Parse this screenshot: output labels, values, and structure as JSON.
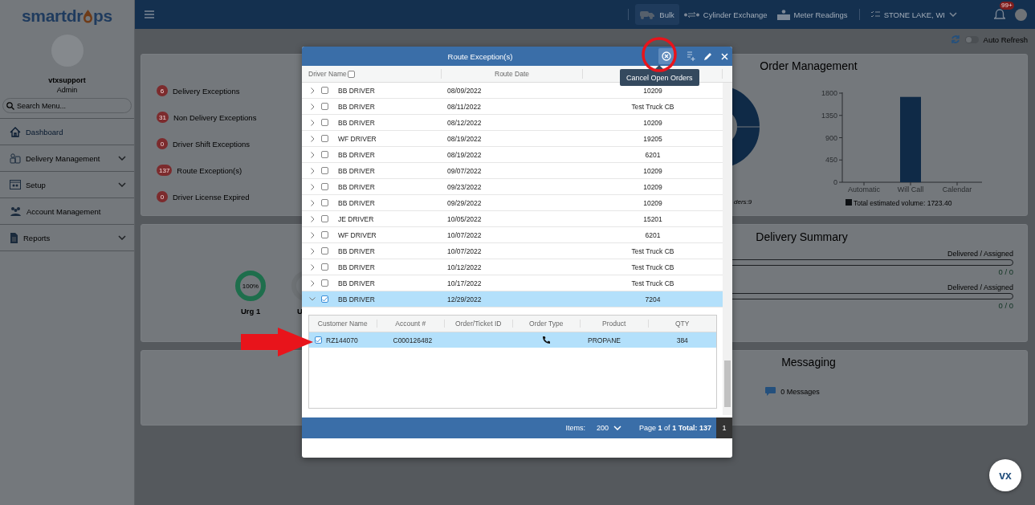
{
  "sidebar": {
    "logo": [
      "smartdr",
      "ps"
    ],
    "user": {
      "name": "vtxsupport",
      "role": "Admin"
    },
    "search": {
      "placeholder": "Search Menu..."
    },
    "items": [
      {
        "label": "Dashboard",
        "selected": true,
        "expandable": false
      },
      {
        "label": "Delivery Management",
        "selected": false,
        "expandable": true
      },
      {
        "label": "Setup",
        "selected": false,
        "expandable": true
      },
      {
        "label": "Account Management",
        "selected": false,
        "expandable": false
      },
      {
        "label": "Reports",
        "selected": false,
        "expandable": true
      }
    ]
  },
  "topbar": {
    "nav": [
      {
        "label": "Bulk",
        "selected": true
      },
      {
        "label": "Cylinder Exchange",
        "selected": false
      },
      {
        "label": "Meter Readings",
        "selected": false
      }
    ],
    "location": "STONE LAKE, WI",
    "notifications": "99+"
  },
  "toolbar": {
    "auto_refresh": {
      "label": "Auto Refresh",
      "on": false
    }
  },
  "exceptions": [
    {
      "count": "6",
      "label": "Delivery Exceptions"
    },
    {
      "count": "31",
      "label": "Non Delivery Exceptions"
    },
    {
      "count": "0",
      "label": "Driver Shift Exceptions"
    },
    {
      "count": "137",
      "label": "Route Exception(s)"
    },
    {
      "count": "0",
      "label": "Driver License Expired"
    }
  ],
  "urgency": [
    {
      "value": "100%",
      "label": "Urg 1",
      "color": "#1e6e4c"
    },
    {
      "label": "U",
      "color": "#6d7174"
    }
  ],
  "order_management": {
    "title": "Order Management",
    "donut_caption": "ders:9",
    "chart_data": {
      "type": "bar",
      "categories": [
        "Automatic",
        "Will Call",
        "Calendar"
      ],
      "series": [
        {
          "name": "Total estimated volume: 1723.40",
          "color": "#0f2a47",
          "values": [
            0,
            1723.4,
            0
          ]
        }
      ],
      "ylim": [
        0,
        1800
      ],
      "yticks": [
        0,
        450,
        900,
        1350,
        1800
      ]
    }
  },
  "delivery_summary": {
    "title": "Delivery Summary",
    "rows": [
      {
        "label": "Delivered / Assigned",
        "reading": "0 / 0",
        "level": 0
      },
      {
        "label": "Delivered / Assigned",
        "reading": "0 / 0",
        "level": 0
      }
    ]
  },
  "messaging": {
    "title": "Messaging",
    "count": "0 Messages"
  },
  "assistant": "vx",
  "dialog": {
    "title": "Route Exception(s)",
    "tooltip": "Cancel Open Orders",
    "columns": [
      "Driver Name",
      "Route Date"
    ],
    "select_all": false,
    "rows": [
      {
        "driver": "BB DRIVER",
        "route_date": "08/09/2022",
        "column_3": "10209",
        "checked": false,
        "selected": false,
        "expanded": false
      },
      {
        "driver": "BB DRIVER",
        "route_date": "08/11/2022",
        "column_3": "Test Truck CB",
        "checked": false,
        "selected": false,
        "expanded": false
      },
      {
        "driver": "BB DRIVER",
        "route_date": "08/12/2022",
        "column_3": "10209",
        "checked": false,
        "selected": false,
        "expanded": false
      },
      {
        "driver": "WF DRIVER",
        "route_date": "08/19/2022",
        "column_3": "19205",
        "checked": false,
        "selected": false,
        "expanded": false
      },
      {
        "driver": "BB DRIVER",
        "route_date": "08/19/2022",
        "column_3": "6201",
        "checked": false,
        "selected": false,
        "expanded": false
      },
      {
        "driver": "BB DRIVER",
        "route_date": "09/07/2022",
        "column_3": "10209",
        "checked": false,
        "selected": false,
        "expanded": false
      },
      {
        "driver": "BB DRIVER",
        "route_date": "09/23/2022",
        "column_3": "10209",
        "checked": false,
        "selected": false,
        "expanded": false
      },
      {
        "driver": "BB DRIVER",
        "route_date": "09/29/2022",
        "column_3": "10209",
        "checked": false,
        "selected": false,
        "expanded": false
      },
      {
        "driver": "JE DRIVER",
        "route_date": "10/05/2022",
        "column_3": "15201",
        "checked": false,
        "selected": false,
        "expanded": false
      },
      {
        "driver": "WF DRIVER",
        "route_date": "10/07/2022",
        "column_3": "6201",
        "checked": false,
        "selected": false,
        "expanded": false
      },
      {
        "driver": "BB DRIVER",
        "route_date": "10/07/2022",
        "column_3": "Test Truck CB",
        "checked": false,
        "selected": false,
        "expanded": false
      },
      {
        "driver": "BB DRIVER",
        "route_date": "10/12/2022",
        "column_3": "Test Truck CB",
        "checked": false,
        "selected": false,
        "expanded": false
      },
      {
        "driver": "BB DRIVER",
        "route_date": "10/17/2022",
        "column_3": "Test Truck CB",
        "checked": false,
        "selected": false,
        "expanded": false
      },
      {
        "driver": "BB DRIVER",
        "route_date": "12/29/2022",
        "column_3": "7204",
        "checked": true,
        "selected": true,
        "expanded": true,
        "orders": {
          "columns": [
            "Customer Name",
            "Account #",
            "Order/Ticket ID",
            "Order Type",
            "Product",
            "QTY"
          ],
          "rows": [
            {
              "customer": "RZ144070",
              "account": "C000126482",
              "product": "PROPANE",
              "qty": "384",
              "checked": true,
              "selected": true
            }
          ]
        }
      }
    ],
    "footer": {
      "items_label": "Items:",
      "page_size": "200",
      "page_info": "Page **1** of **1** **Total: 137**",
      "page": "1"
    }
  },
  "annotations": [
    {
      "kind": "circle"
    },
    {
      "kind": "arrow"
    }
  ]
}
